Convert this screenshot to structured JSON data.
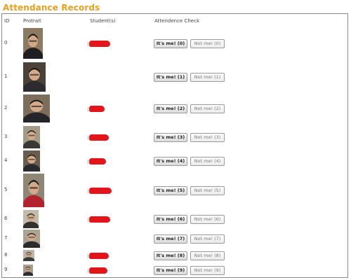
{
  "page_title": "Attendance Records",
  "columns": {
    "id": "ID",
    "portrait": "Protrait",
    "students": "Student(s)",
    "check": "Attendence Check"
  },
  "rows": [
    {
      "id": "0",
      "yes": "It's me! (0)",
      "no": "Not me! (0)",
      "student_redacted": true
    },
    {
      "id": "1",
      "yes": "It's me! (1)",
      "no": "Not me! (1)",
      "student_redacted": false
    },
    {
      "id": "2",
      "yes": "It's me! (2)",
      "no": "Not me! (2)",
      "student_redacted": true
    },
    {
      "id": "3",
      "yes": "It's me! (3)",
      "no": "Not me! (3)",
      "student_redacted": true
    },
    {
      "id": "4",
      "yes": "It's me! (4)",
      "no": "Not me! (4)",
      "student_redacted": true
    },
    {
      "id": "5",
      "yes": "It's me! (5)",
      "no": "Not me! (5)",
      "student_redacted": true
    },
    {
      "id": "6",
      "yes": "It's me! (6)",
      "no": "Not me! (6)",
      "student_redacted": true
    },
    {
      "id": "7",
      "yes": "It's me! (7)",
      "no": "Not me! (7)",
      "student_redacted": false
    },
    {
      "id": "8",
      "yes": "It's me! (8)",
      "no": "Not me! (8)",
      "student_redacted": true
    },
    {
      "id": "9",
      "yes": "It's me! (9)",
      "no": "Not me! (9)",
      "student_redacted": true
    }
  ],
  "colors": {
    "title": "#e8a020",
    "redaction": "#e4141b",
    "frame": "#8a8a8a"
  }
}
